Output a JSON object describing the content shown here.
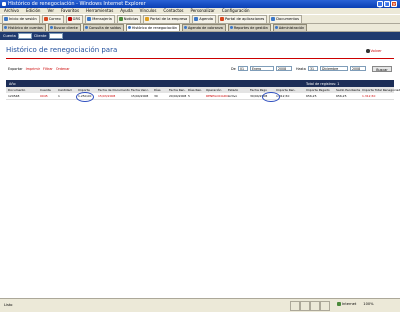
{
  "window": {
    "title": "Histórico de renegociación - Windows Internet Explorer"
  },
  "menu": [
    "Archivo",
    "Edición",
    "Ver",
    "Favoritos",
    "Herramientas",
    "Ayuda",
    "Vínculos",
    "Contactos",
    "Personalizar",
    "Configuración"
  ],
  "favorites": [
    {
      "label": "Inicio de sesión",
      "color": "#3c78c8"
    },
    {
      "label": "Correo",
      "color": "#d9461d"
    },
    {
      "label": "GRS",
      "color": "#c00000"
    },
    {
      "label": "Mensajería",
      "color": "#3c78c8"
    },
    {
      "label": "Noticias",
      "color": "#4a8a3a"
    },
    {
      "label": "Portal de la empresa",
      "color": "#e0a020"
    },
    {
      "label": "Agenda",
      "color": "#3c78c8"
    },
    {
      "label": "Portal de aplicaciones",
      "color": "#d9461d"
    },
    {
      "label": "Documentos",
      "color": "#3c78c8"
    }
  ],
  "tabs": [
    {
      "label": "Histórico de cuentas",
      "active": false
    },
    {
      "label": "Buscar cliente",
      "active": false
    },
    {
      "label": "Consulta de saldos",
      "active": false
    },
    {
      "label": "Histórico de renegociación",
      "active": true
    },
    {
      "label": "Agenda de cobranza",
      "active": false
    },
    {
      "label": "Reportes de gestión",
      "active": false
    },
    {
      "label": "Administración",
      "active": false
    }
  ],
  "subtoolbar": {
    "label1": "Cuenta",
    "label2": "Cliente"
  },
  "page": {
    "title": "Histórico de renegociación para",
    "back_label": "Volver",
    "filter_links": [
      "Exportar",
      "Imprimir",
      "Filtrar",
      "Ordenar"
    ],
    "from_label": "De",
    "from_day": "01",
    "from_month": "Enero",
    "from_year": "2008",
    "to_label": "Hasta",
    "to_day": "31",
    "to_month": "Diciembre",
    "to_year": "2008",
    "go_button": "Buscar",
    "grid_title": "Año",
    "grid_right": "Total de registros: 1"
  },
  "table": {
    "columns": [
      "Documento",
      "Cuenta",
      "Cantidad",
      "Importe",
      "Fecha de Documento",
      "Fecha Venc.",
      "Días",
      "Fecha Ren.",
      "Días Ren.",
      "Operación",
      "Estado",
      "Fecha Pago",
      "Importe Ren.",
      "Importe Pagado",
      "Saldo Pendiente",
      "Importe Total Renegociado"
    ],
    "rows": [
      [
        "120548",
        "0045",
        "1",
        "1.250,00",
        "15/03/2008",
        "15/04/2008",
        "30",
        "20/04/2008",
        "5",
        "RENEGOCIADO",
        "Activo",
        "30/04/2008",
        "1.312,50",
        "656,25",
        "656,25",
        "1.312,50"
      ]
    ]
  },
  "status": {
    "text": "Listo",
    "zone": "Internet",
    "zoom": "100%"
  }
}
